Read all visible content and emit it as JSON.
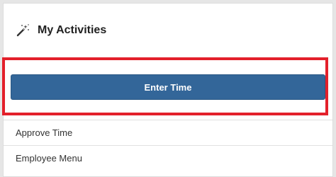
{
  "panel": {
    "title": "My Activities",
    "title_icon": "magic-wand-icon"
  },
  "primary_action": {
    "label": "Enter Time",
    "color": "#336699",
    "highlight_color": "#e3202b"
  },
  "menu": {
    "items": [
      {
        "label": "Approve Time"
      },
      {
        "label": "Employee Menu"
      }
    ]
  }
}
